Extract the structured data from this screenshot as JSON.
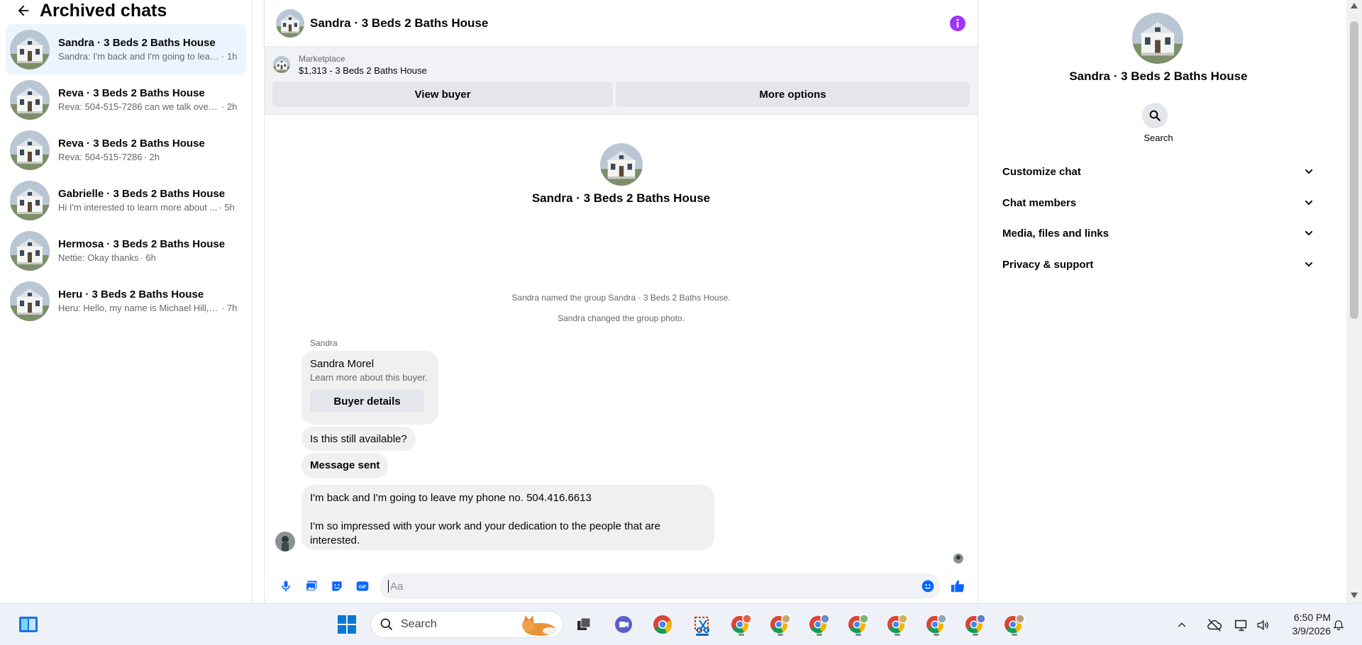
{
  "sidebar": {
    "title": "Archived chats",
    "chats": [
      {
        "name": "Sandra · 3 Beds 2 Baths House",
        "preview": "Sandra: I'm back and I'm going to leav...",
        "time": "· 1h"
      },
      {
        "name": "Reva · 3 Beds 2 Baths House",
        "preview": "Reva: 504-515-7286 can we talk over ...",
        "time": "· 2h"
      },
      {
        "name": "Reva · 3 Beds 2 Baths House",
        "preview": "Reva: 504-515-7286",
        "time": "· 2h"
      },
      {
        "name": "Gabrielle · 3 Beds 2 Baths House",
        "preview": "Hi I'm interested to learn more about ...",
        "time": "· 5h"
      },
      {
        "name": "Hermosa · 3 Beds 2 Baths House",
        "preview": "Nettie: Okay thanks",
        "time": "· 6h"
      },
      {
        "name": "Heru · 3 Beds 2 Baths House",
        "preview": "Heru: Hello, my name is Michael Hill, r...",
        "time": "· 7h"
      }
    ]
  },
  "conversation": {
    "title": "Sandra · 3 Beds 2 Baths House",
    "marketplace_label": "Marketplace",
    "listing": "$1,313 - 3 Beds 2 Baths House",
    "view_buyer_label": "View buyer",
    "more_options_label": "More options",
    "intro_name": "Sandra · 3 Beds 2 Baths House",
    "system_messages": [
      "Sandra named the group Sandra · 3 Beds 2 Baths House.",
      "Sandra changed the group photo."
    ],
    "sender": "Sandra",
    "buyer_card": {
      "name": "Sandra Morel",
      "subtitle": "Learn more about this buyer.",
      "button": "Buyer details"
    },
    "messages": [
      "Is this still available?",
      "Message sent"
    ],
    "long_message": {
      "line1": "I'm back and I'm going to leave my phone no. 504.416.6613",
      "line2": "I'm so impressed with your work and your dedication to the people that are interested."
    },
    "composer_placeholder": "Aa"
  },
  "info_panel": {
    "name": "Sandra · 3 Beds 2 Baths House",
    "search_label": "Search",
    "sections": [
      "Customize chat",
      "Chat members",
      "Media, files and links",
      "Privacy & support"
    ]
  },
  "taskbar": {
    "search_label": "Search",
    "time": "6:50 PM",
    "date": "3/9/2026"
  },
  "colors": {
    "accent": "#0866ff",
    "info_icon": "#a033ff",
    "active_chat_bg": "#ebf5ff"
  }
}
